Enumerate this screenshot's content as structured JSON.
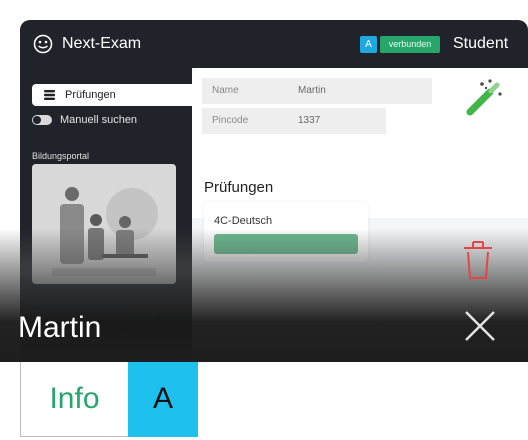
{
  "titlebar": {
    "app_name": "Next-Exam",
    "badge_letter": "A",
    "connection_status": "verbunden",
    "user_role": "Student"
  },
  "sidebar": {
    "nav_exams_label": "Prüfungen",
    "manual_search_label": "Manuell suchen",
    "portal_section_label": "Bildungsportal"
  },
  "student": {
    "name_label": "Name",
    "name_value": "Martin",
    "pincode_label": "Pincode",
    "pincode_value": "1337"
  },
  "exams": {
    "section_title": "Prüfungen",
    "items": [
      {
        "name": "4C-Deutsch"
      }
    ]
  },
  "overlay": {
    "student_name": "Martin"
  },
  "footer": {
    "info_label": "Info",
    "badge_letter": "A"
  },
  "colors": {
    "sidebar_bg": "#202329",
    "connected_green": "#27a66b",
    "accent_cyan": "#1ec0ee",
    "trash_red": "#e04848"
  }
}
